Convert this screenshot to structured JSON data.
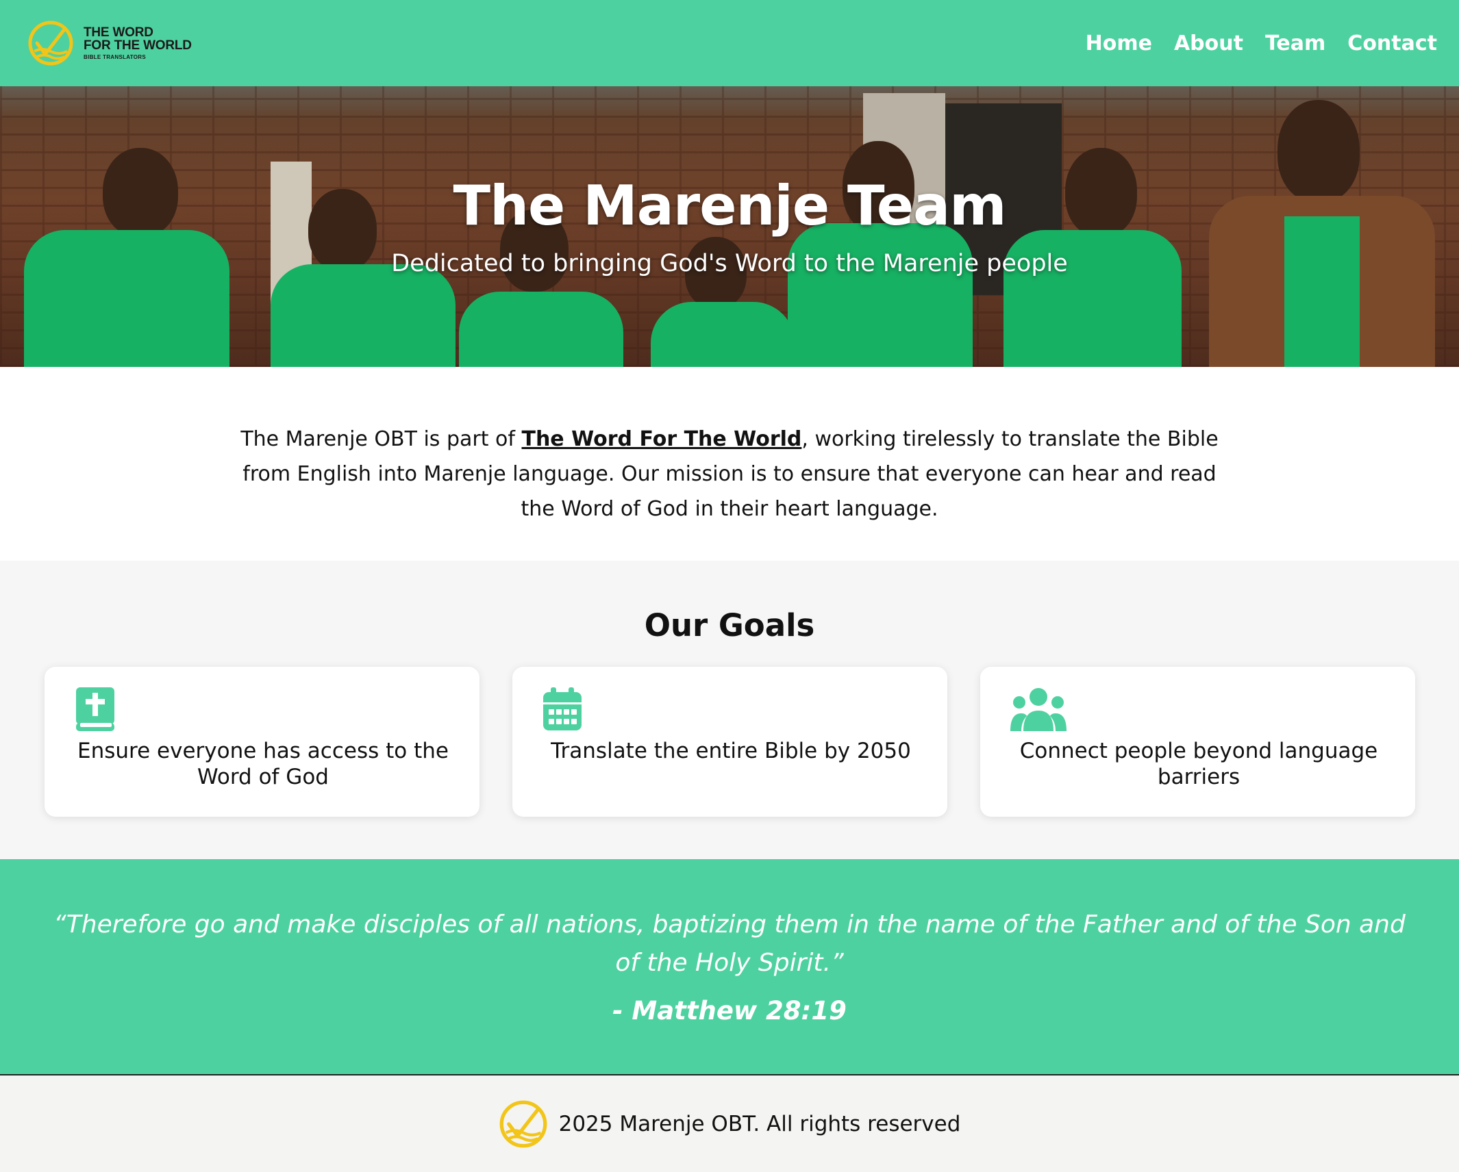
{
  "header": {
    "logo": {
      "line1": "THE WORD",
      "line2": "FOR THE WORLD",
      "line3": "BIBLE TRANSLATORS",
      "icon": "logo-icon"
    },
    "nav": [
      {
        "label": "Home"
      },
      {
        "label": "About"
      },
      {
        "label": "Team"
      },
      {
        "label": "Contact"
      }
    ]
  },
  "hero": {
    "title": "The Marenje Team",
    "subtitle": "Dedicated to bringing God's Word to the Marenje people"
  },
  "intro": {
    "text_before": "The Marenje OBT is part of ",
    "link_text": "The Word For The World",
    "text_after": ", working tirelessly to translate the Bible from English into Marenje language. Our mission is to ensure that everyone can hear and read the Word of God in their heart language."
  },
  "goals": {
    "title": "Our Goals",
    "items": [
      {
        "icon": "bible-icon",
        "text": "Ensure everyone has access to the Word of God"
      },
      {
        "icon": "calendar-icon",
        "text": "Translate the entire Bible by 2050"
      },
      {
        "icon": "people-group-icon",
        "text": "Connect people beyond language barriers"
      }
    ]
  },
  "quote": {
    "text": "“Therefore go and make disciples of all nations, baptizing them in the name of the Father and of the Son and of the Holy Spirit.”",
    "reference": "- Matthew 28:19"
  },
  "footer": {
    "text": "2025 Marenje OBT. All rights reserved"
  },
  "colors": {
    "accent": "#4ed1a0",
    "logo_yellow": "#f2c518",
    "text": "#111111",
    "section_bg": "#f6f6f6",
    "footer_bg": "#f4f4f2"
  }
}
